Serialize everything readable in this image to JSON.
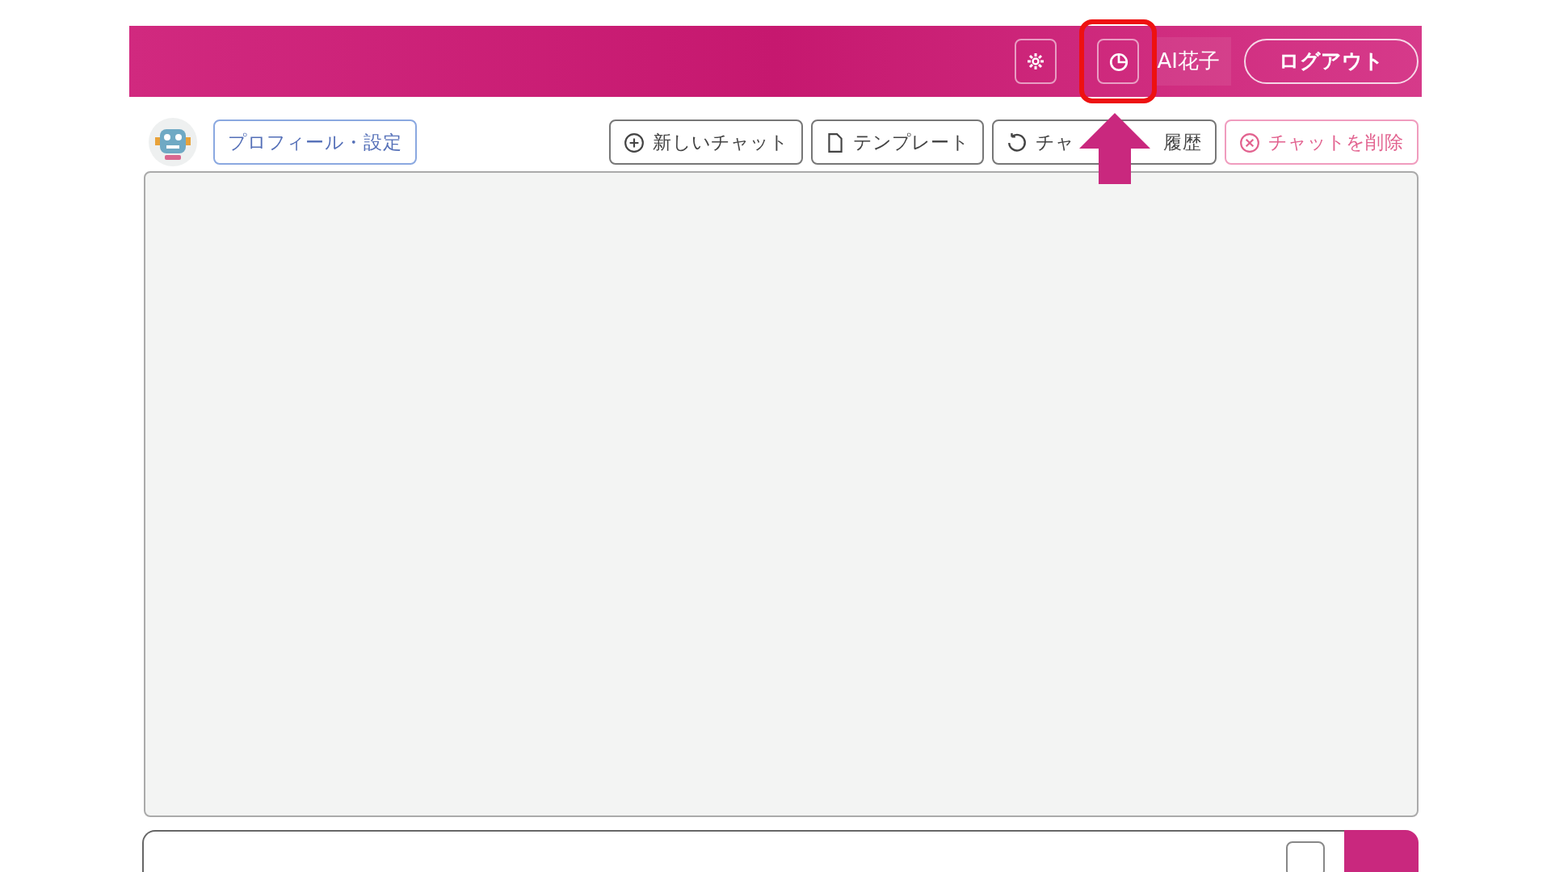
{
  "header": {
    "icon_buttons": [
      {
        "kind": "gear",
        "highlighted": false
      },
      {
        "kind": "pie",
        "highlighted": true
      }
    ],
    "user_name": "AI花子",
    "logout": "ログアウト"
  },
  "toolbar": {
    "profile_button": "プロフィール・設定",
    "actions": [
      {
        "kind": "plus",
        "label": "新しいチャット"
      },
      {
        "kind": "doc",
        "label": "テンプレート"
      },
      {
        "kind": "history",
        "label_parts": [
          "チャ",
          "履歴"
        ]
      },
      {
        "kind": "delete",
        "label": "チャットを削除"
      }
    ]
  }
}
